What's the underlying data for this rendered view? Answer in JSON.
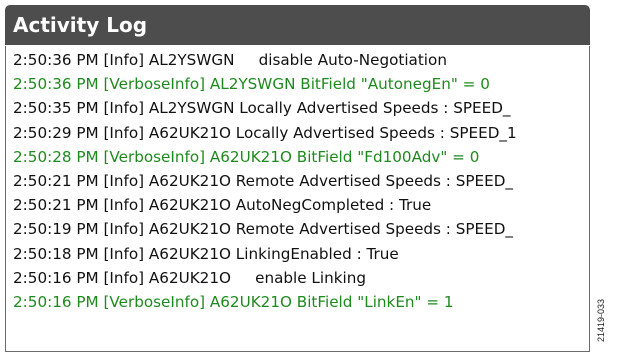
{
  "panel": {
    "title": "Activity Log"
  },
  "log": {
    "entries": [
      {
        "text": "2:50:36 PM [Info] AL2YSWGN     disable Auto-Negotiation",
        "level": "info"
      },
      {
        "text": "2:50:36 PM [VerboseInfo] AL2YSWGN BitField \"AutonegEn\" = 0",
        "level": "verbose"
      },
      {
        "text": "2:50:35 PM [Info] AL2YSWGN Locally Advertised Speeds : SPEED_",
        "level": "info"
      },
      {
        "text": "2:50:29 PM [Info] A62UK21O Locally Advertised Speeds : SPEED_1",
        "level": "info"
      },
      {
        "text": "2:50:28 PM [VerboseInfo] A62UK21O BitField \"Fd100Adv\" = 0",
        "level": "verbose"
      },
      {
        "text": "2:50:21 PM [Info] A62UK21O Remote Advertised Speeds : SPEED_",
        "level": "info"
      },
      {
        "text": "2:50:21 PM [Info] A62UK21O AutoNegCompleted : True",
        "level": "info"
      },
      {
        "text": "2:50:19 PM [Info] A62UK21O Remote Advertised Speeds : SPEED_",
        "level": "info"
      },
      {
        "text": "2:50:18 PM [Info] A62UK21O LinkingEnabled : True",
        "level": "info"
      },
      {
        "text": "2:50:16 PM [Info] A62UK21O     enable Linking",
        "level": "info"
      },
      {
        "text": "2:50:16 PM [VerboseInfo] A62UK21O BitField \"LinkEn\" = 1",
        "level": "verbose"
      }
    ]
  },
  "figure_id": "21419-033",
  "colors": {
    "header_bg": "#4d4d4d",
    "info_text": "#111111",
    "verbose_text": "#1e8a1e"
  }
}
